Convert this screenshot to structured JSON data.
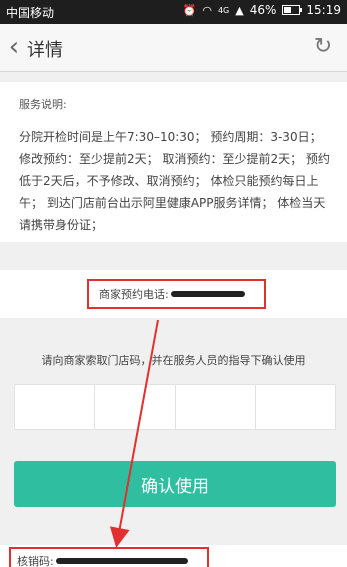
{
  "status_bar": {
    "carrier": "中国移动",
    "network": "4G",
    "battery": "46%",
    "battery_level": 0.46,
    "time": "15:19"
  },
  "nav": {
    "back_icon": "chevron-left-icon",
    "title": "详情",
    "refresh_icon": "refresh-icon"
  },
  "service": {
    "title": "服务说明:",
    "body": "分院开检时间是上午7:30–10:30；  预约周期：3-30日；  修改预约：至少提前2天；  取消预约：至少提前2天；  预约低于2天后，不予修改、取消预约；  体检只能预约每日上午；  到达门店前台出示阿里健康APP服务详情；  体检当天请携带身份证；"
  },
  "merchant": {
    "phone_label": "商家预约电话:"
  },
  "instruction": "请向商家索取门店码，并在服务人员的指导下确认使用",
  "confirm_button": "确认使用",
  "verify": {
    "label": "核销码:"
  },
  "colors": {
    "accent": "#2fbfa0",
    "highlight": "#e0302f"
  }
}
